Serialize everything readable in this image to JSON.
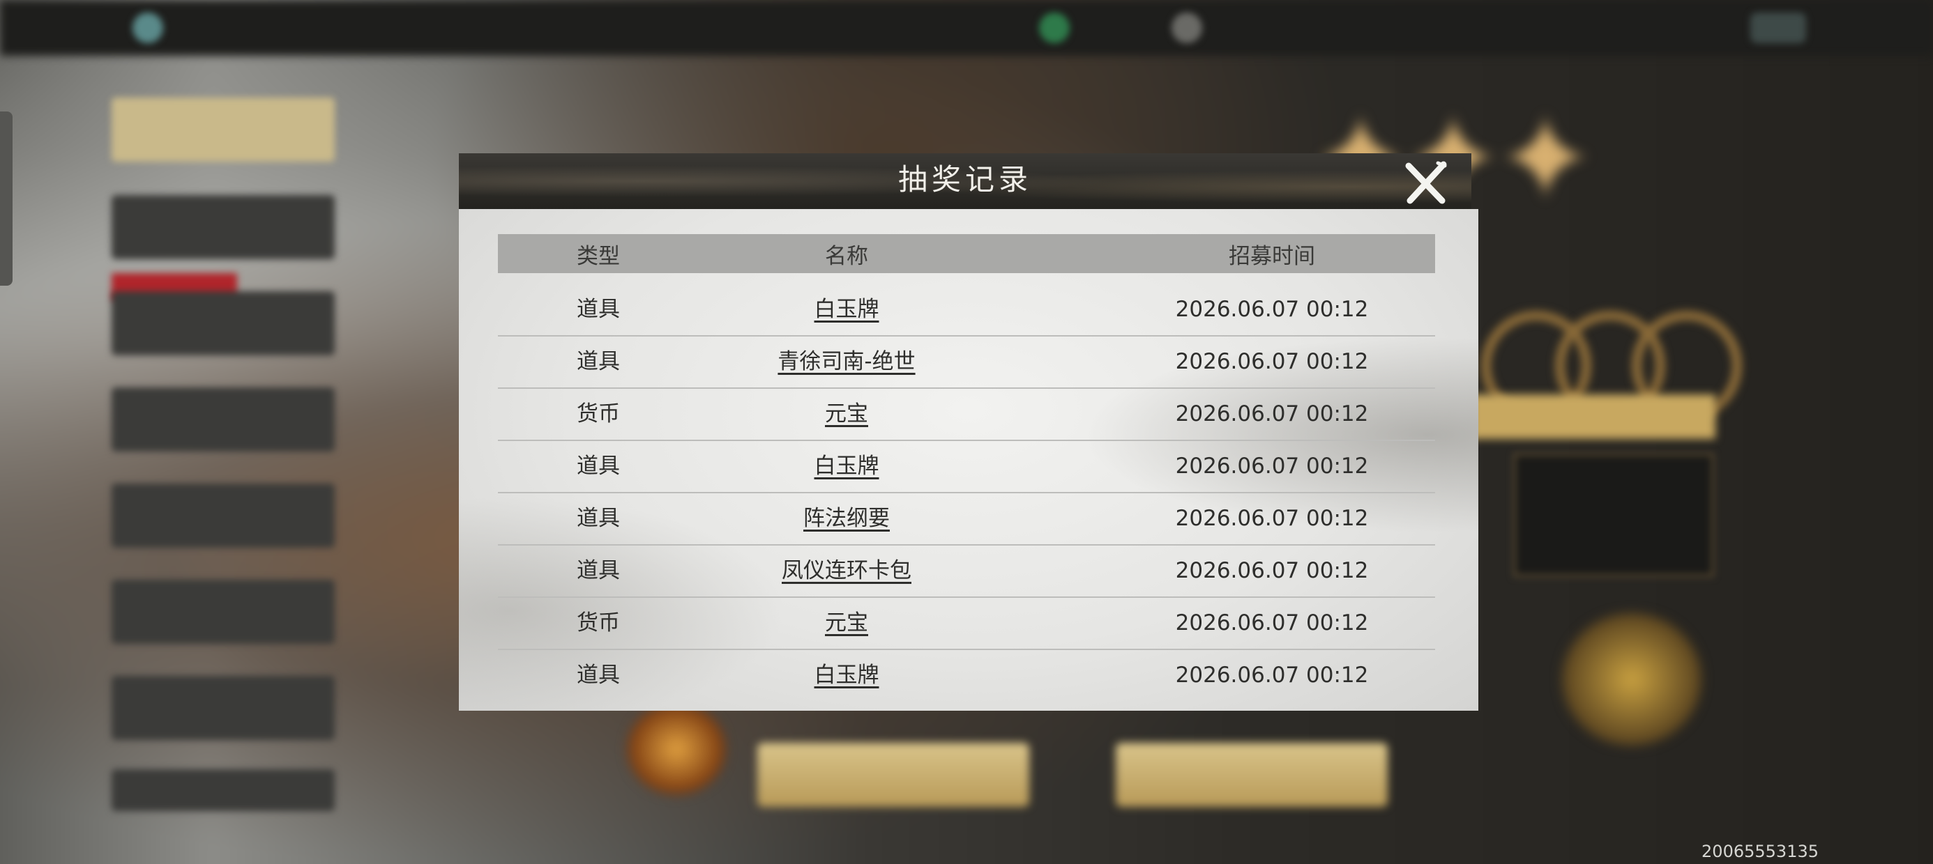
{
  "dialog": {
    "title": "抽奖记录",
    "close_icon": "close-x-icon"
  },
  "table": {
    "headers": {
      "type": "类型",
      "name": "名称",
      "time": "招募时间"
    },
    "rows": [
      {
        "type": "道具",
        "name": "白玉牌",
        "time": "2026.06.07 00:12"
      },
      {
        "type": "道具",
        "name": "青徐司南-绝世",
        "time": "2026.06.07 00:12"
      },
      {
        "type": "货币",
        "name": "元宝",
        "time": "2026.06.07 00:12"
      },
      {
        "type": "道具",
        "name": "白玉牌",
        "time": "2026.06.07 00:12"
      },
      {
        "type": "道具",
        "name": "阵法纲要",
        "time": "2026.06.07 00:12"
      },
      {
        "type": "道具",
        "name": "凤仪连环卡包",
        "time": "2026.06.07 00:12"
      },
      {
        "type": "货币",
        "name": "元宝",
        "time": "2026.06.07 00:12"
      },
      {
        "type": "道具",
        "name": "白玉牌",
        "time": "2026.06.07 00:12"
      }
    ]
  },
  "build_number": "20065553135",
  "colors": {
    "header_bar": "#a9a9a7",
    "dialog_header": "#2e2c28",
    "dialog_body": "#e8e8e6",
    "text": "#2e2e2c"
  }
}
